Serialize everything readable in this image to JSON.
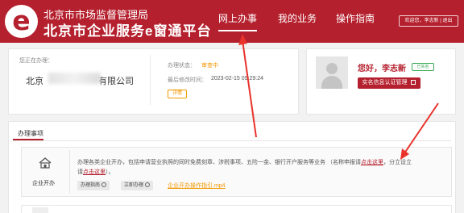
{
  "header": {
    "org_name": "北京市市场监督管理局",
    "platform_name": "北京市企业服务e窗通平台",
    "logo_letter": "e",
    "nav": [
      {
        "label": "网上办事",
        "active": true
      },
      {
        "label": "我的业务",
        "active": false
      },
      {
        "label": "操作指南",
        "active": false
      }
    ],
    "user_info": "欢迎您，李志新 | 退出"
  },
  "status_card": {
    "location_label": "您正在办理：",
    "company_prefix": "北京",
    "company_suffix": "有限公司",
    "status_label": "办理状态：",
    "status_value": "审查中",
    "modified_label": "最后修改时间：",
    "modified_value": "2023-02-15 09:29:24",
    "detail_button": "详情"
  },
  "user_card": {
    "greeting": "您好，李志新",
    "verified_badge": "已实名",
    "auth_button": "实名信息认证管理"
  },
  "section": {
    "tab_title": "办理事项"
  },
  "item": {
    "name": "企业开办",
    "desc_line1": "办理各类企业开办，包括申请营业执照的同时免费刻章、涉税事项、五险一金、银行开户服务等业务 （名称申报请",
    "link1": "点击这里",
    "desc_line1_tail": "，分立设立",
    "desc_line2_prefix": "请",
    "link2": "点击这里",
    "desc_line2_tail": "）。",
    "btn_guide": "办理指南",
    "btn_start": "立即办理",
    "guide_file": "企业开办操作指引.mp4"
  },
  "colors": {
    "brand": "#b5202e",
    "accent_orange": "#f39800",
    "verified_green": "#3aa957",
    "annotation_arrow": "#e8322b"
  }
}
